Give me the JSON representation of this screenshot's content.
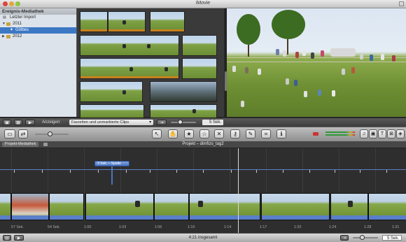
{
  "window": {
    "title": "iMovie"
  },
  "library": {
    "header": "Ereignis-Mediathek",
    "items": [
      {
        "label": "Letzter Import",
        "icon": "film-icon"
      },
      {
        "label": "2011",
        "icon": "folder-icon",
        "expanded": true
      },
      {
        "label": "Gölbes",
        "icon": "star-icon",
        "selected": true
      },
      {
        "label": "2012",
        "icon": "folder-icon",
        "expanded": false
      }
    ]
  },
  "browser_toolbar": {
    "show_label": "Anzeigen:",
    "show_selected": "Favoriten und unmarkierte Clips",
    "zoom_value": "5 Sek.",
    "zoom_level": 0.35
  },
  "main_toolbar": {
    "tools": [
      "pointer-tool",
      "hand-tool",
      "favorite-tool",
      "unmark-tool",
      "reject-tool",
      "keyword-tool",
      "eyedropper-tool",
      "crop-tool",
      "info-tool"
    ],
    "volume_level": 0.45
  },
  "project": {
    "tab_label": "Projekt-Mediathek",
    "title": "Projekt – dimfizo_tag2"
  },
  "timeline": {
    "title_clip": "3 Sek. – Spalte",
    "ruler": [
      "57 Sek.",
      "54 Sek.",
      "1:00",
      "1:03",
      "1:06",
      "1:10",
      "1:14",
      "1:17",
      "1:20",
      "1:24",
      "1:28",
      "1:31"
    ]
  },
  "status": {
    "total": "4:21 insgesamt",
    "zoom_value": "5 Sek."
  },
  "colors": {
    "selection": "#3d78c5",
    "audio": "#5a7fc8",
    "favorite_bar": "#d97f1b"
  }
}
